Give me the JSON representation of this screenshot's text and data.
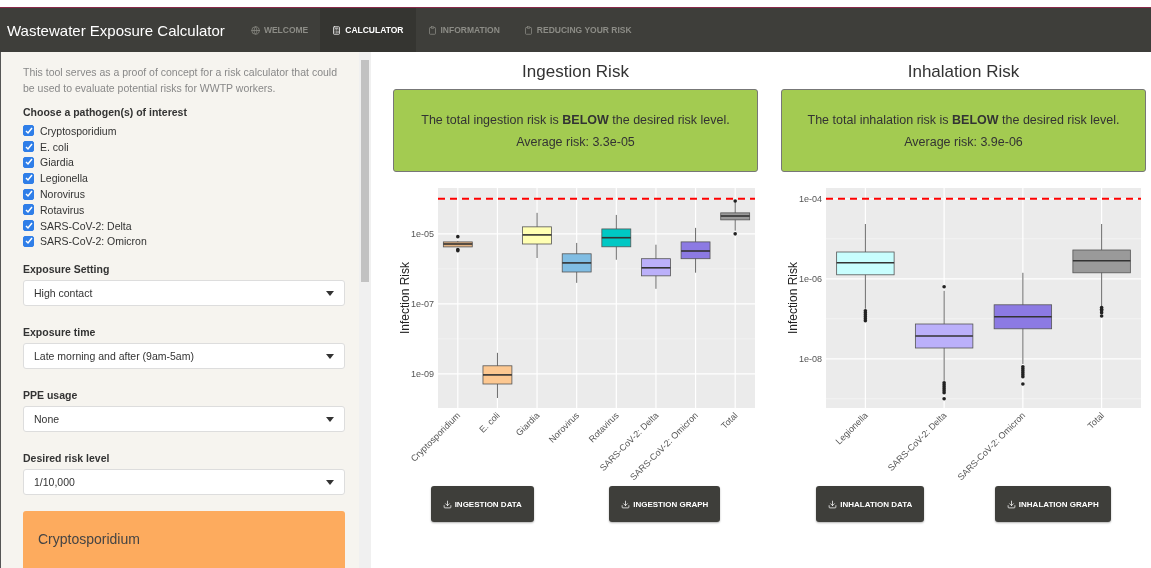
{
  "navbar": {
    "title": "Wastewater Exposure Calculator",
    "tabs": [
      {
        "label": "WELCOME",
        "selected": false
      },
      {
        "label": "CALCULATOR",
        "selected": true
      },
      {
        "label": "INFORMATION",
        "selected": false
      },
      {
        "label": "REDUCING YOUR RISK",
        "selected": false
      }
    ]
  },
  "sidebar": {
    "intro": "This tool serves as a proof of concept for a risk calculator that could be used to evaluate potential risks for WWTP workers.",
    "pathogen_label": "Choose a pathogen(s) of interest",
    "pathogens": [
      {
        "label": "Cryptosporidium",
        "checked": true
      },
      {
        "label": "E. coli",
        "checked": true
      },
      {
        "label": "Giardia",
        "checked": true
      },
      {
        "label": "Legionella",
        "checked": true
      },
      {
        "label": "Norovirus",
        "checked": true
      },
      {
        "label": "Rotavirus",
        "checked": true
      },
      {
        "label": "SARS-CoV-2: Delta",
        "checked": true
      },
      {
        "label": "SARS-CoV-2: Omicron",
        "checked": true
      }
    ],
    "selects": [
      {
        "label": "Exposure Setting",
        "value": "High contact"
      },
      {
        "label": "Exposure time",
        "value": "Late morning and after (9am-5am)"
      },
      {
        "label": "PPE usage",
        "value": "None"
      },
      {
        "label": "Desired risk level",
        "value": "1/10,000"
      }
    ],
    "card": {
      "title": "Cryptosporidium"
    }
  },
  "panels": [
    {
      "title": "Ingestion Risk",
      "result": {
        "message": "The total ingestion risk is **BELOW** the desired risk level.",
        "average": "Average risk: 3.3e-05"
      },
      "chart": {
        "ylabel": "Infection Risk",
        "yticks": [
          "1e-05",
          "1e-07",
          "1e-09"
        ],
        "categories": [
          {
            "label": "Cryptosporidium",
            "color": "#e3b383"
          },
          {
            "label": "E. coli",
            "color": "#fdc891"
          },
          {
            "label": "Giardia",
            "color": "#ffffb3"
          },
          {
            "label": "Norovirus",
            "color": "#80bde3"
          },
          {
            "label": "Rotavirus",
            "color": "#00c8c4"
          },
          {
            "label": "SARS-CoV-2: Delta",
            "color": "#bbb0fa"
          },
          {
            "label": "SARS-CoV-2: Omicron",
            "color": "#8c7ae3"
          },
          {
            "label": "Total",
            "color": "#9a9a9a"
          }
        ]
      },
      "buttons": [
        "INGESTION DATA",
        "INGESTION GRAPH"
      ]
    },
    {
      "title": "Inhalation Risk",
      "result": {
        "message": "The total inhalation risk is **BELOW** the desired risk level.",
        "average": "Average risk: 3.9e-06"
      },
      "chart": {
        "ylabel": "Infection Risk",
        "yticks": [
          "1e-04",
          "1e-06",
          "1e-08"
        ],
        "categories": [
          {
            "label": "Legionella",
            "color": "#c8fefe"
          },
          {
            "label": "SARS-CoV-2: Delta",
            "color": "#bbb0fa"
          },
          {
            "label": "SARS-CoV-2: Omicron",
            "color": "#8c7ae3"
          },
          {
            "label": "Total",
            "color": "#9a9a9a"
          }
        ]
      },
      "buttons": [
        "INHALATION DATA",
        "INHALATION GRAPH"
      ]
    }
  ]
}
